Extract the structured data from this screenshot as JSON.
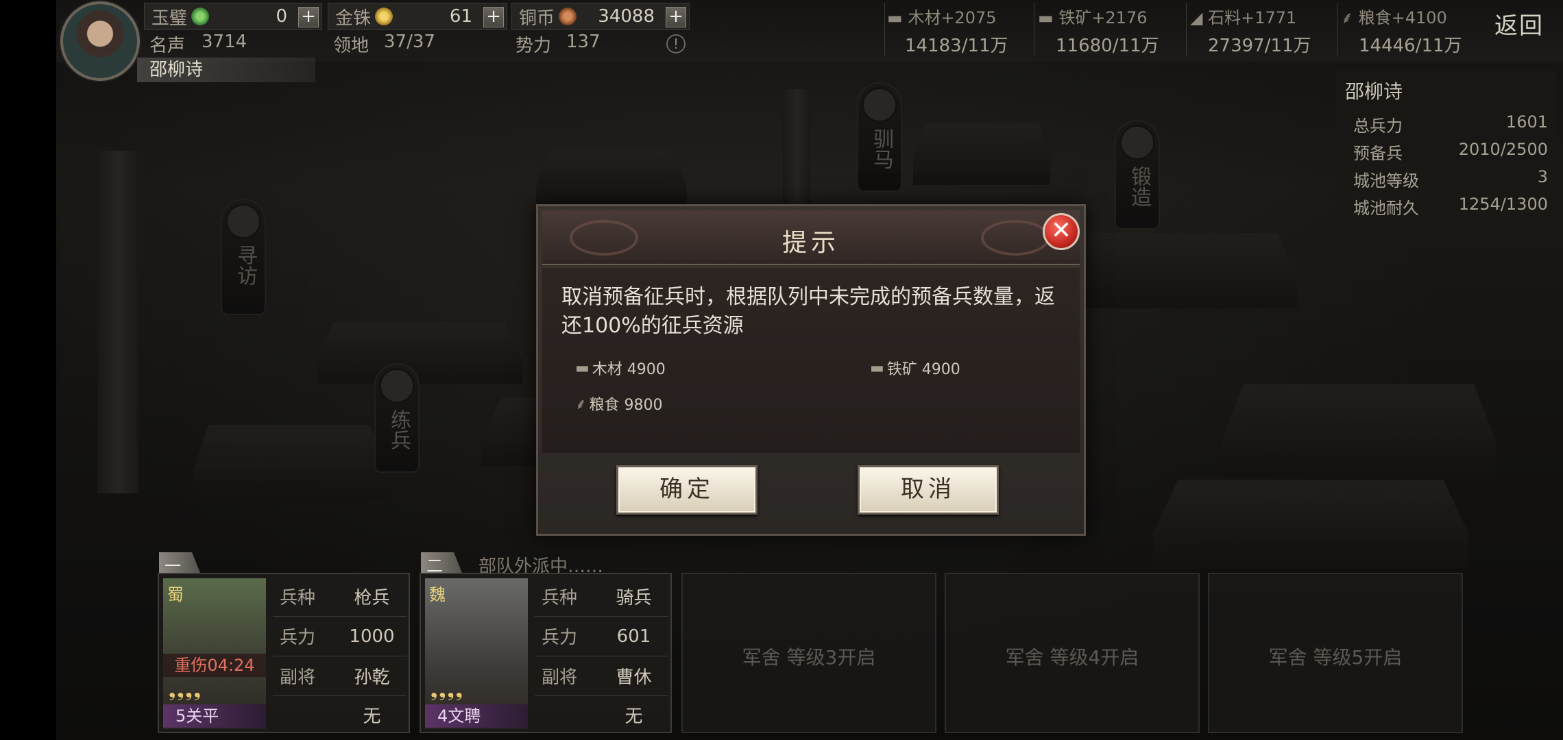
{
  "topbar": {
    "player_name": "邵柳诗",
    "resources": [
      {
        "label": "玉璧",
        "value": "0"
      },
      {
        "label": "金铢",
        "value": "61"
      },
      {
        "label": "铜币",
        "value": "34088"
      }
    ],
    "fame_label": "名声",
    "fame_value": "3714",
    "territory_label": "领地",
    "territory_value": "37/37",
    "power_label": "势力",
    "power_value": "137",
    "production": [
      {
        "label": "木材+2075",
        "cap": "14183/11万"
      },
      {
        "label": "铁矿+2176",
        "cap": "11680/11万"
      },
      {
        "label": "石料+1771",
        "cap": "27397/11万"
      },
      {
        "label": "粮食+4100",
        "cap": "14446/11万"
      }
    ],
    "back_label": "返回"
  },
  "city_info": {
    "title": "邵柳诗",
    "rows": [
      {
        "k": "总兵力",
        "v": "1601"
      },
      {
        "k": "预备兵",
        "v": "2010/2500"
      },
      {
        "k": "城池等级",
        "v": "3"
      },
      {
        "k": "城池耐久",
        "v": "1254/1300"
      }
    ]
  },
  "buildings": {
    "xunfang": "寻访",
    "lianbing": "练兵",
    "xunma": "驯马",
    "duanzao": "锻造"
  },
  "dialog": {
    "title": "提示",
    "message": "取消预备征兵时，根据队列中未完成的预备兵数量，返还100%的征兵资源",
    "costs": {
      "wood": "木材 4900",
      "iron": "铁矿 4900",
      "food": "粮食 9800"
    },
    "confirm_label": "确定",
    "cancel_label": "取消",
    "close_glyph": "✕"
  },
  "troops": {
    "dispatch_text": "部队外派中……",
    "team1": {
      "tab": "一",
      "faction": "蜀",
      "injury": "重伤04:24",
      "stars": "❟❟❟❟",
      "name": "5关平",
      "rows": [
        {
          "k": "兵种",
          "v": "枪兵"
        },
        {
          "k": "兵力",
          "v": "1000"
        },
        {
          "k": "副将",
          "v": "孙乾"
        },
        {
          "k": "",
          "v": "无"
        }
      ]
    },
    "team2": {
      "tab": "二",
      "faction": "魏",
      "stars": "❟❟❟❟",
      "name": "4文聘",
      "rows": [
        {
          "k": "兵种",
          "v": "骑兵"
        },
        {
          "k": "兵力",
          "v": "601"
        },
        {
          "k": "副将",
          "v": "曹休"
        },
        {
          "k": "",
          "v": "无"
        }
      ]
    },
    "locked": [
      "军舍 等级3开启",
      "军舍 等级4开启",
      "军舍 等级5开启"
    ]
  }
}
